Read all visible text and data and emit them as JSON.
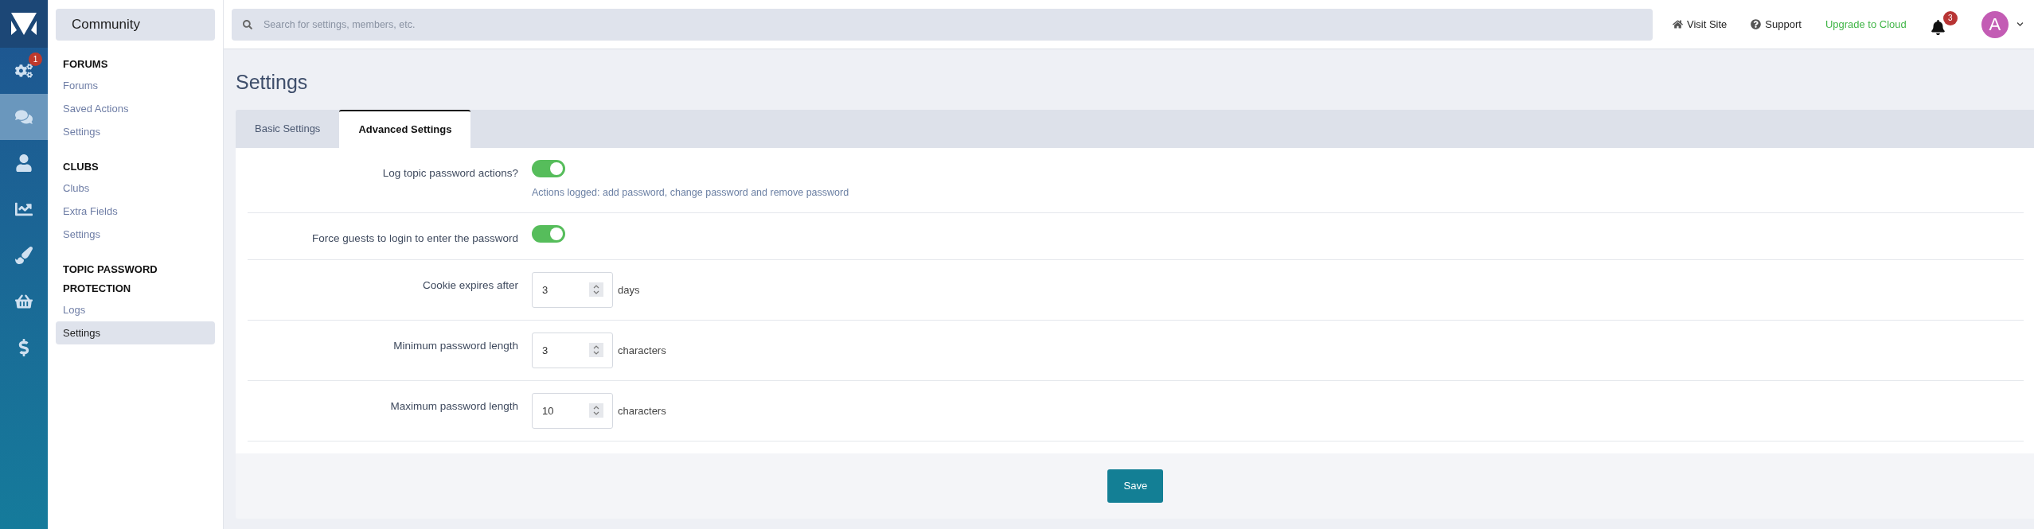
{
  "rail": [
    {
      "kind": "logo",
      "selected": false
    },
    {
      "kind": "gears",
      "badge": "1",
      "selected": false
    },
    {
      "kind": "chat",
      "selected": true
    },
    {
      "kind": "user",
      "selected": false
    },
    {
      "kind": "chart",
      "selected": false
    },
    {
      "kind": "brush",
      "selected": false
    },
    {
      "kind": "basket",
      "selected": false
    },
    {
      "kind": "dollar",
      "selected": false
    }
  ],
  "sidebar": {
    "title": "Community",
    "sections": [
      {
        "heading": "FORUMS",
        "items": [
          {
            "label": "Forums",
            "selected": false
          },
          {
            "label": "Saved Actions",
            "selected": false
          },
          {
            "label": "Settings",
            "selected": false
          }
        ]
      },
      {
        "heading": "CLUBS",
        "items": [
          {
            "label": "Clubs",
            "selected": false
          },
          {
            "label": "Extra Fields",
            "selected": false
          },
          {
            "label": "Settings",
            "selected": false
          }
        ]
      },
      {
        "heading": "TOPIC PASSWORD PROTECTION",
        "items": [
          {
            "label": "Logs",
            "selected": false
          },
          {
            "label": "Settings",
            "selected": true
          }
        ]
      }
    ]
  },
  "top_bar": {
    "search": {
      "placeholder": "Search for settings, members, etc."
    },
    "links": [
      {
        "kind": "home",
        "label": "Visit Site"
      },
      {
        "kind": "help",
        "label": "Support"
      },
      {
        "kind": "upgrade",
        "label": "Upgrade to Cloud"
      }
    ],
    "notifications": {
      "badge": "3"
    },
    "avatar": {
      "letter": "A"
    }
  },
  "page": {
    "title": "Settings",
    "tabs": [
      {
        "label": "Basic Settings",
        "selected": false
      },
      {
        "label": "Advanced Settings",
        "selected": true
      }
    ],
    "fields": [
      {
        "kind": "toggle",
        "label": "Log topic password actions?",
        "on": true,
        "description": "Actions logged: add password, change password and remove password"
      },
      {
        "kind": "toggle",
        "label": "Force guests to login to enter the password",
        "on": true
      },
      {
        "kind": "number",
        "label": "Cookie expires after",
        "value": "3",
        "unit": "days"
      },
      {
        "kind": "number",
        "label": "Minimum password length",
        "value": "3",
        "unit": "characters"
      },
      {
        "kind": "number",
        "label": "Maximum password length",
        "value": "10",
        "unit": "characters"
      }
    ],
    "save_button": "Save"
  }
}
